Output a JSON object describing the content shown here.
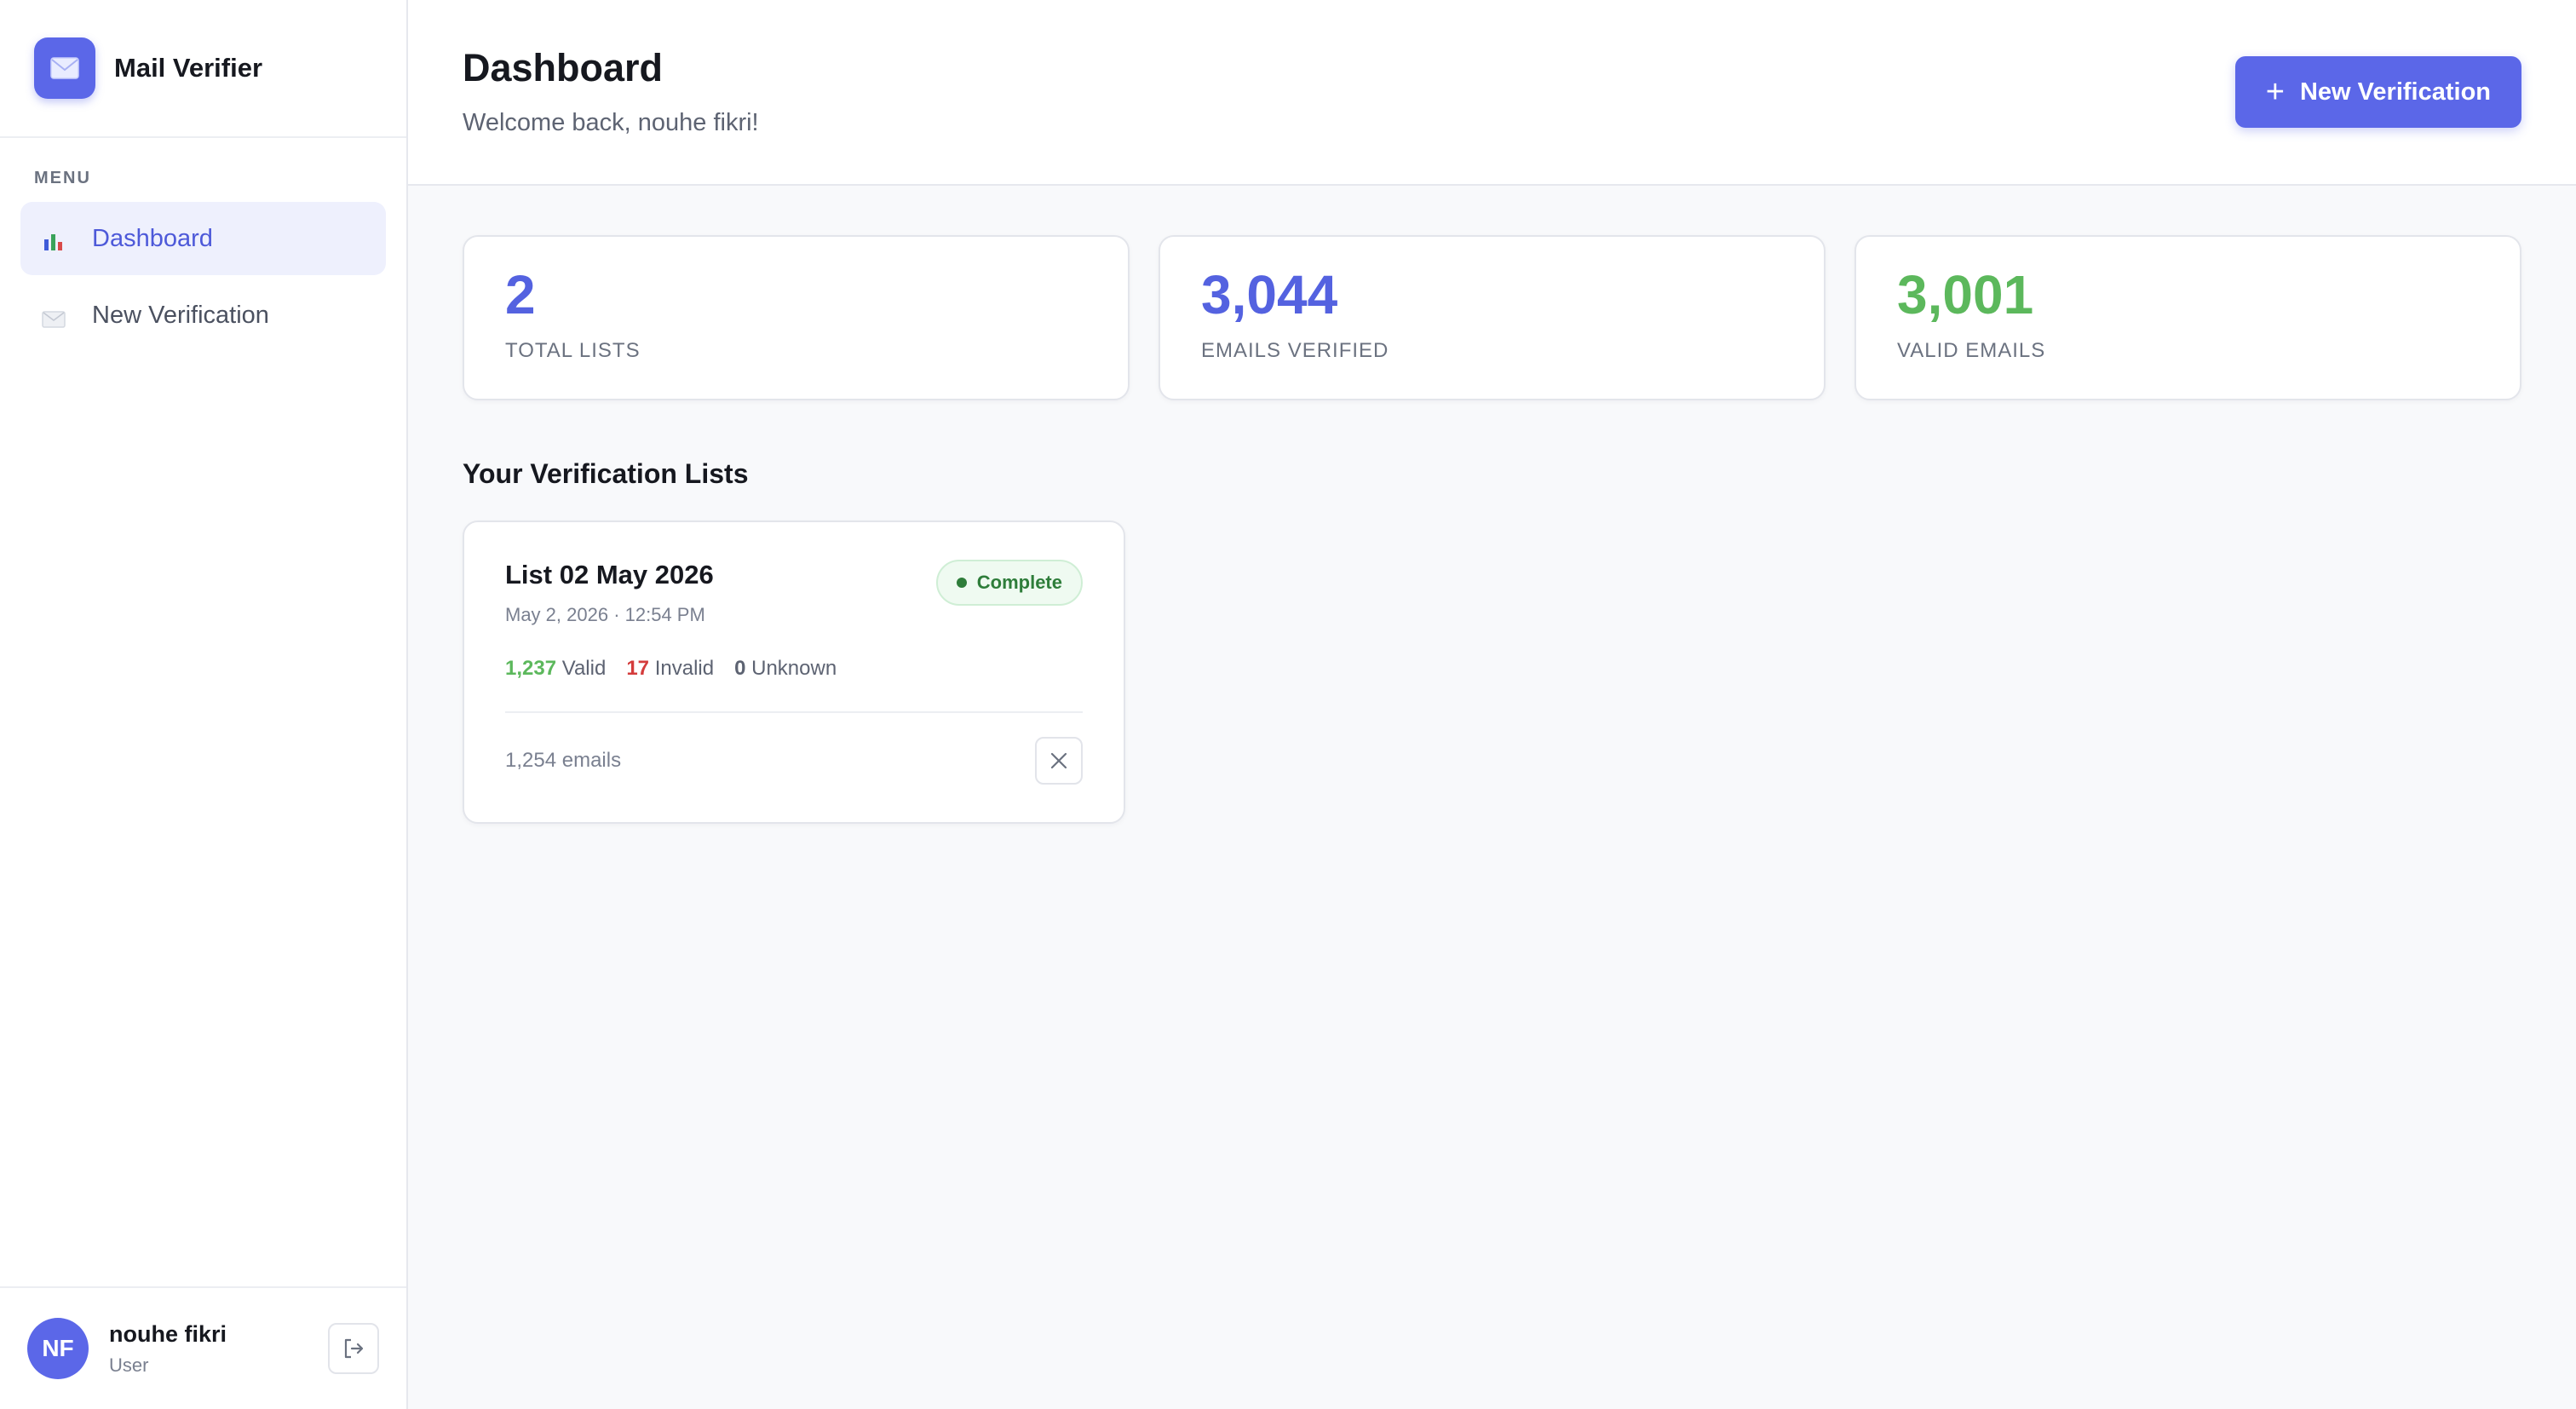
{
  "brand": {
    "name": "Mail Verifier",
    "icon": "envelope-icon",
    "accent": "#5b67e8"
  },
  "sidebar": {
    "menu_label": "MENU",
    "items": [
      {
        "label": "Dashboard",
        "icon": "bar-chart-icon",
        "active": true
      },
      {
        "label": "New Verification",
        "icon": "envelope-icon",
        "active": false
      }
    ],
    "user": {
      "initials": "NF",
      "name": "nouhe fikri",
      "role": "User"
    }
  },
  "header": {
    "title": "Dashboard",
    "subtitle": "Welcome back, nouhe fikri!",
    "primary_button": "New Verification"
  },
  "stats": [
    {
      "value": "2",
      "label": "TOTAL LISTS",
      "color": "#5462e0"
    },
    {
      "value": "3,044",
      "label": "EMAILS VERIFIED",
      "color": "#5462e0"
    },
    {
      "value": "3,001",
      "label": "VALID EMAILS",
      "color": "#5cb85c"
    }
  ],
  "lists_section": {
    "title": "Your Verification Lists",
    "lists": [
      {
        "name": "List 02 May 2026",
        "date": "May 2, 2026 · 12:54 PM",
        "status": "Complete",
        "valid_count": "1,237",
        "valid_label": "Valid",
        "invalid_count": "17",
        "invalid_label": "Invalid",
        "unknown_count": "0",
        "unknown_label": "Unknown",
        "emails": "1,254 emails"
      }
    ]
  }
}
